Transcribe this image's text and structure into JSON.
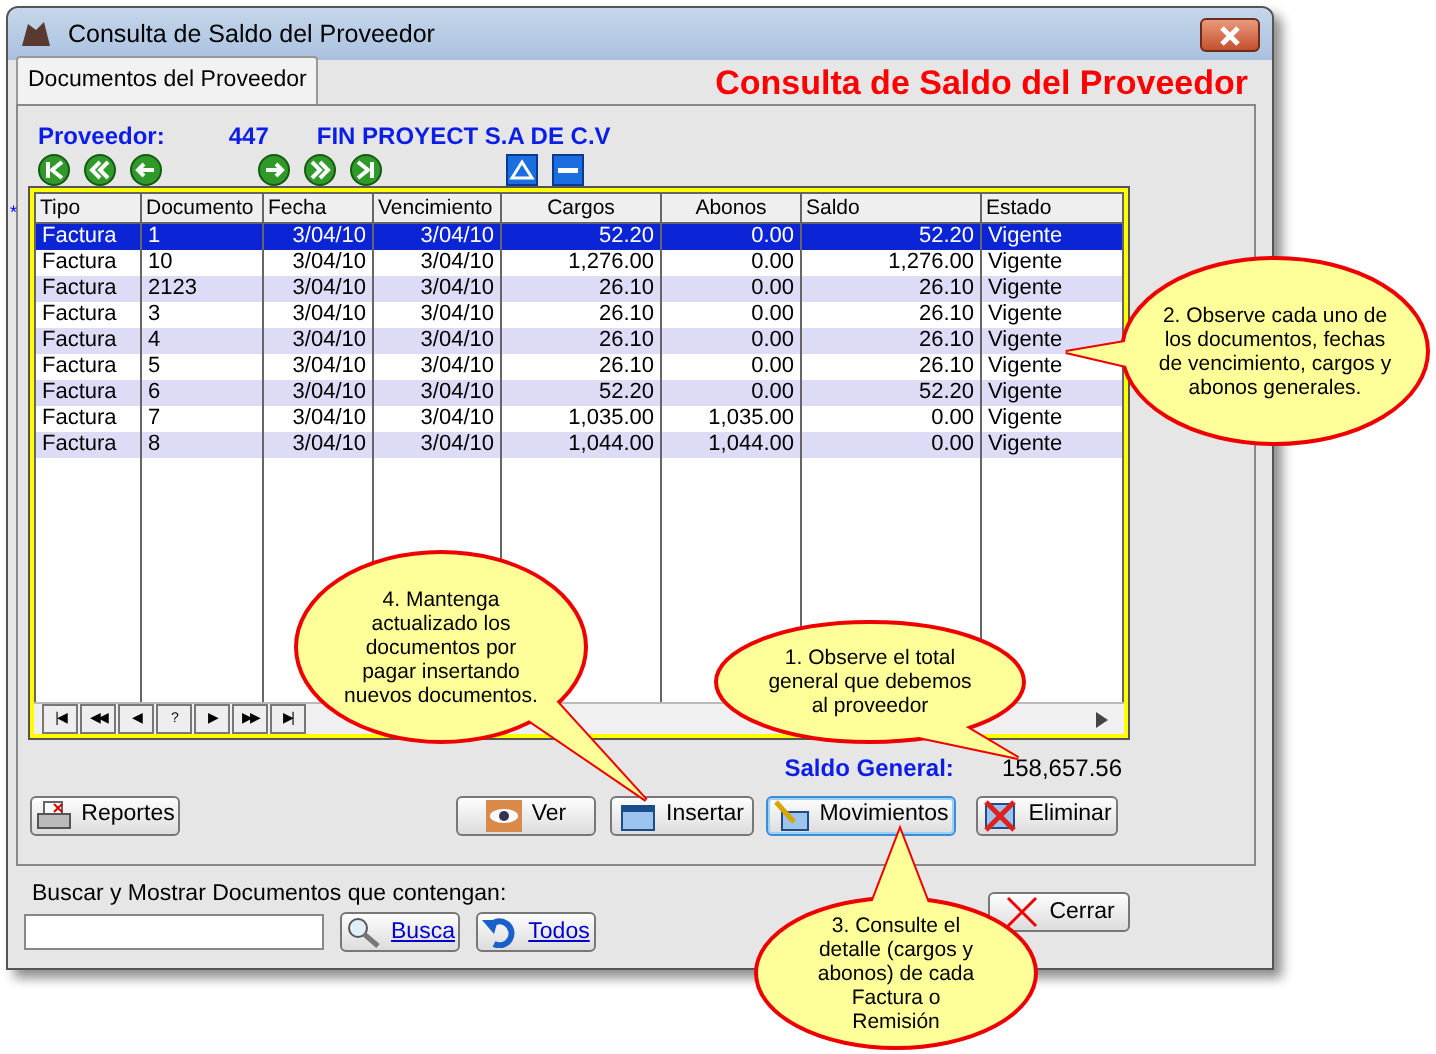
{
  "window": {
    "title": "Consulta de Saldo del Proveedor"
  },
  "tabs": [
    {
      "label": "Documentos del Proveedor",
      "selected": true
    }
  ],
  "heading": "Consulta de Saldo del Proveedor",
  "supplier": {
    "label": "Proveedor:",
    "number": "447",
    "name": "FIN PROYECT S.A DE C.V"
  },
  "row_marker": "*",
  "table": {
    "columns": [
      "Tipo",
      "Documento",
      "Fecha",
      "Vencimiento",
      "Cargos",
      "Abonos",
      "Saldo",
      "Estado"
    ],
    "rows": [
      {
        "cells": [
          "Factura",
          "1",
          "3/04/10",
          "3/04/10",
          "52.20",
          "0.00",
          "52.20",
          "Vigente"
        ],
        "selected": true
      },
      {
        "cells": [
          "Factura",
          "10",
          "3/04/10",
          "3/04/10",
          "1,276.00",
          "0.00",
          "1,276.00",
          "Vigente"
        ],
        "selected": false
      },
      {
        "cells": [
          "Factura",
          "2123",
          "3/04/10",
          "3/04/10",
          "26.10",
          "0.00",
          "26.10",
          "Vigente"
        ],
        "selected": false
      },
      {
        "cells": [
          "Factura",
          "3",
          "3/04/10",
          "3/04/10",
          "26.10",
          "0.00",
          "26.10",
          "Vigente"
        ],
        "selected": false
      },
      {
        "cells": [
          "Factura",
          "4",
          "3/04/10",
          "3/04/10",
          "26.10",
          "0.00",
          "26.10",
          "Vigente"
        ],
        "selected": false
      },
      {
        "cells": [
          "Factura",
          "5",
          "3/04/10",
          "3/04/10",
          "26.10",
          "0.00",
          "26.10",
          "Vigente"
        ],
        "selected": false
      },
      {
        "cells": [
          "Factura",
          "6",
          "3/04/10",
          "3/04/10",
          "52.20",
          "0.00",
          "52.20",
          "Vigente"
        ],
        "selected": false
      },
      {
        "cells": [
          "Factura",
          "7",
          "3/04/10",
          "3/04/10",
          "1,035.00",
          "1,035.00",
          "0.00",
          "Vigente"
        ],
        "selected": false
      },
      {
        "cells": [
          "Factura",
          "8",
          "3/04/10",
          "3/04/10",
          "1,044.00",
          "1,044.00",
          "0.00",
          "Vigente"
        ],
        "selected": false
      }
    ]
  },
  "navigator": [
    "|◀",
    "◀◀",
    "◀",
    "?",
    "▶",
    "▶▶",
    "▶|"
  ],
  "saldo_general": {
    "label": "Saldo General:",
    "value": "158,657.56"
  },
  "buttons": [
    {
      "label": "Reportes",
      "kind": "printer"
    },
    {
      "label": "Ver",
      "kind": "eye"
    },
    {
      "label": "Insertar",
      "kind": "insert"
    },
    {
      "label": "Movimientos",
      "kind": "pencil"
    },
    {
      "label": "Eliminar",
      "kind": "delete"
    }
  ],
  "search": {
    "label": "Buscar y Mostrar Documentos que contengan:",
    "buttons": [
      {
        "label": "Busca",
        "kind": "search"
      },
      {
        "label": "Todos",
        "kind": "undo"
      }
    ]
  },
  "close_button": {
    "label": "Cerrar"
  },
  "callouts": [
    {
      "text": "1. Observe el total general que debemos al proveedor",
      "kind": "total"
    },
    {
      "text": "2. Observe cada uno de los documentos, fechas de vencimiento, cargos y abonos generales.",
      "kind": "documents"
    },
    {
      "text": "3. Consulte el detalle (cargos y abonos) de cada Factura o Remisión",
      "kind": "movements"
    },
    {
      "text": "4. Mantenga actualizado los documentos por pagar insertando nuevos documentos.",
      "kind": "insert"
    }
  ]
}
